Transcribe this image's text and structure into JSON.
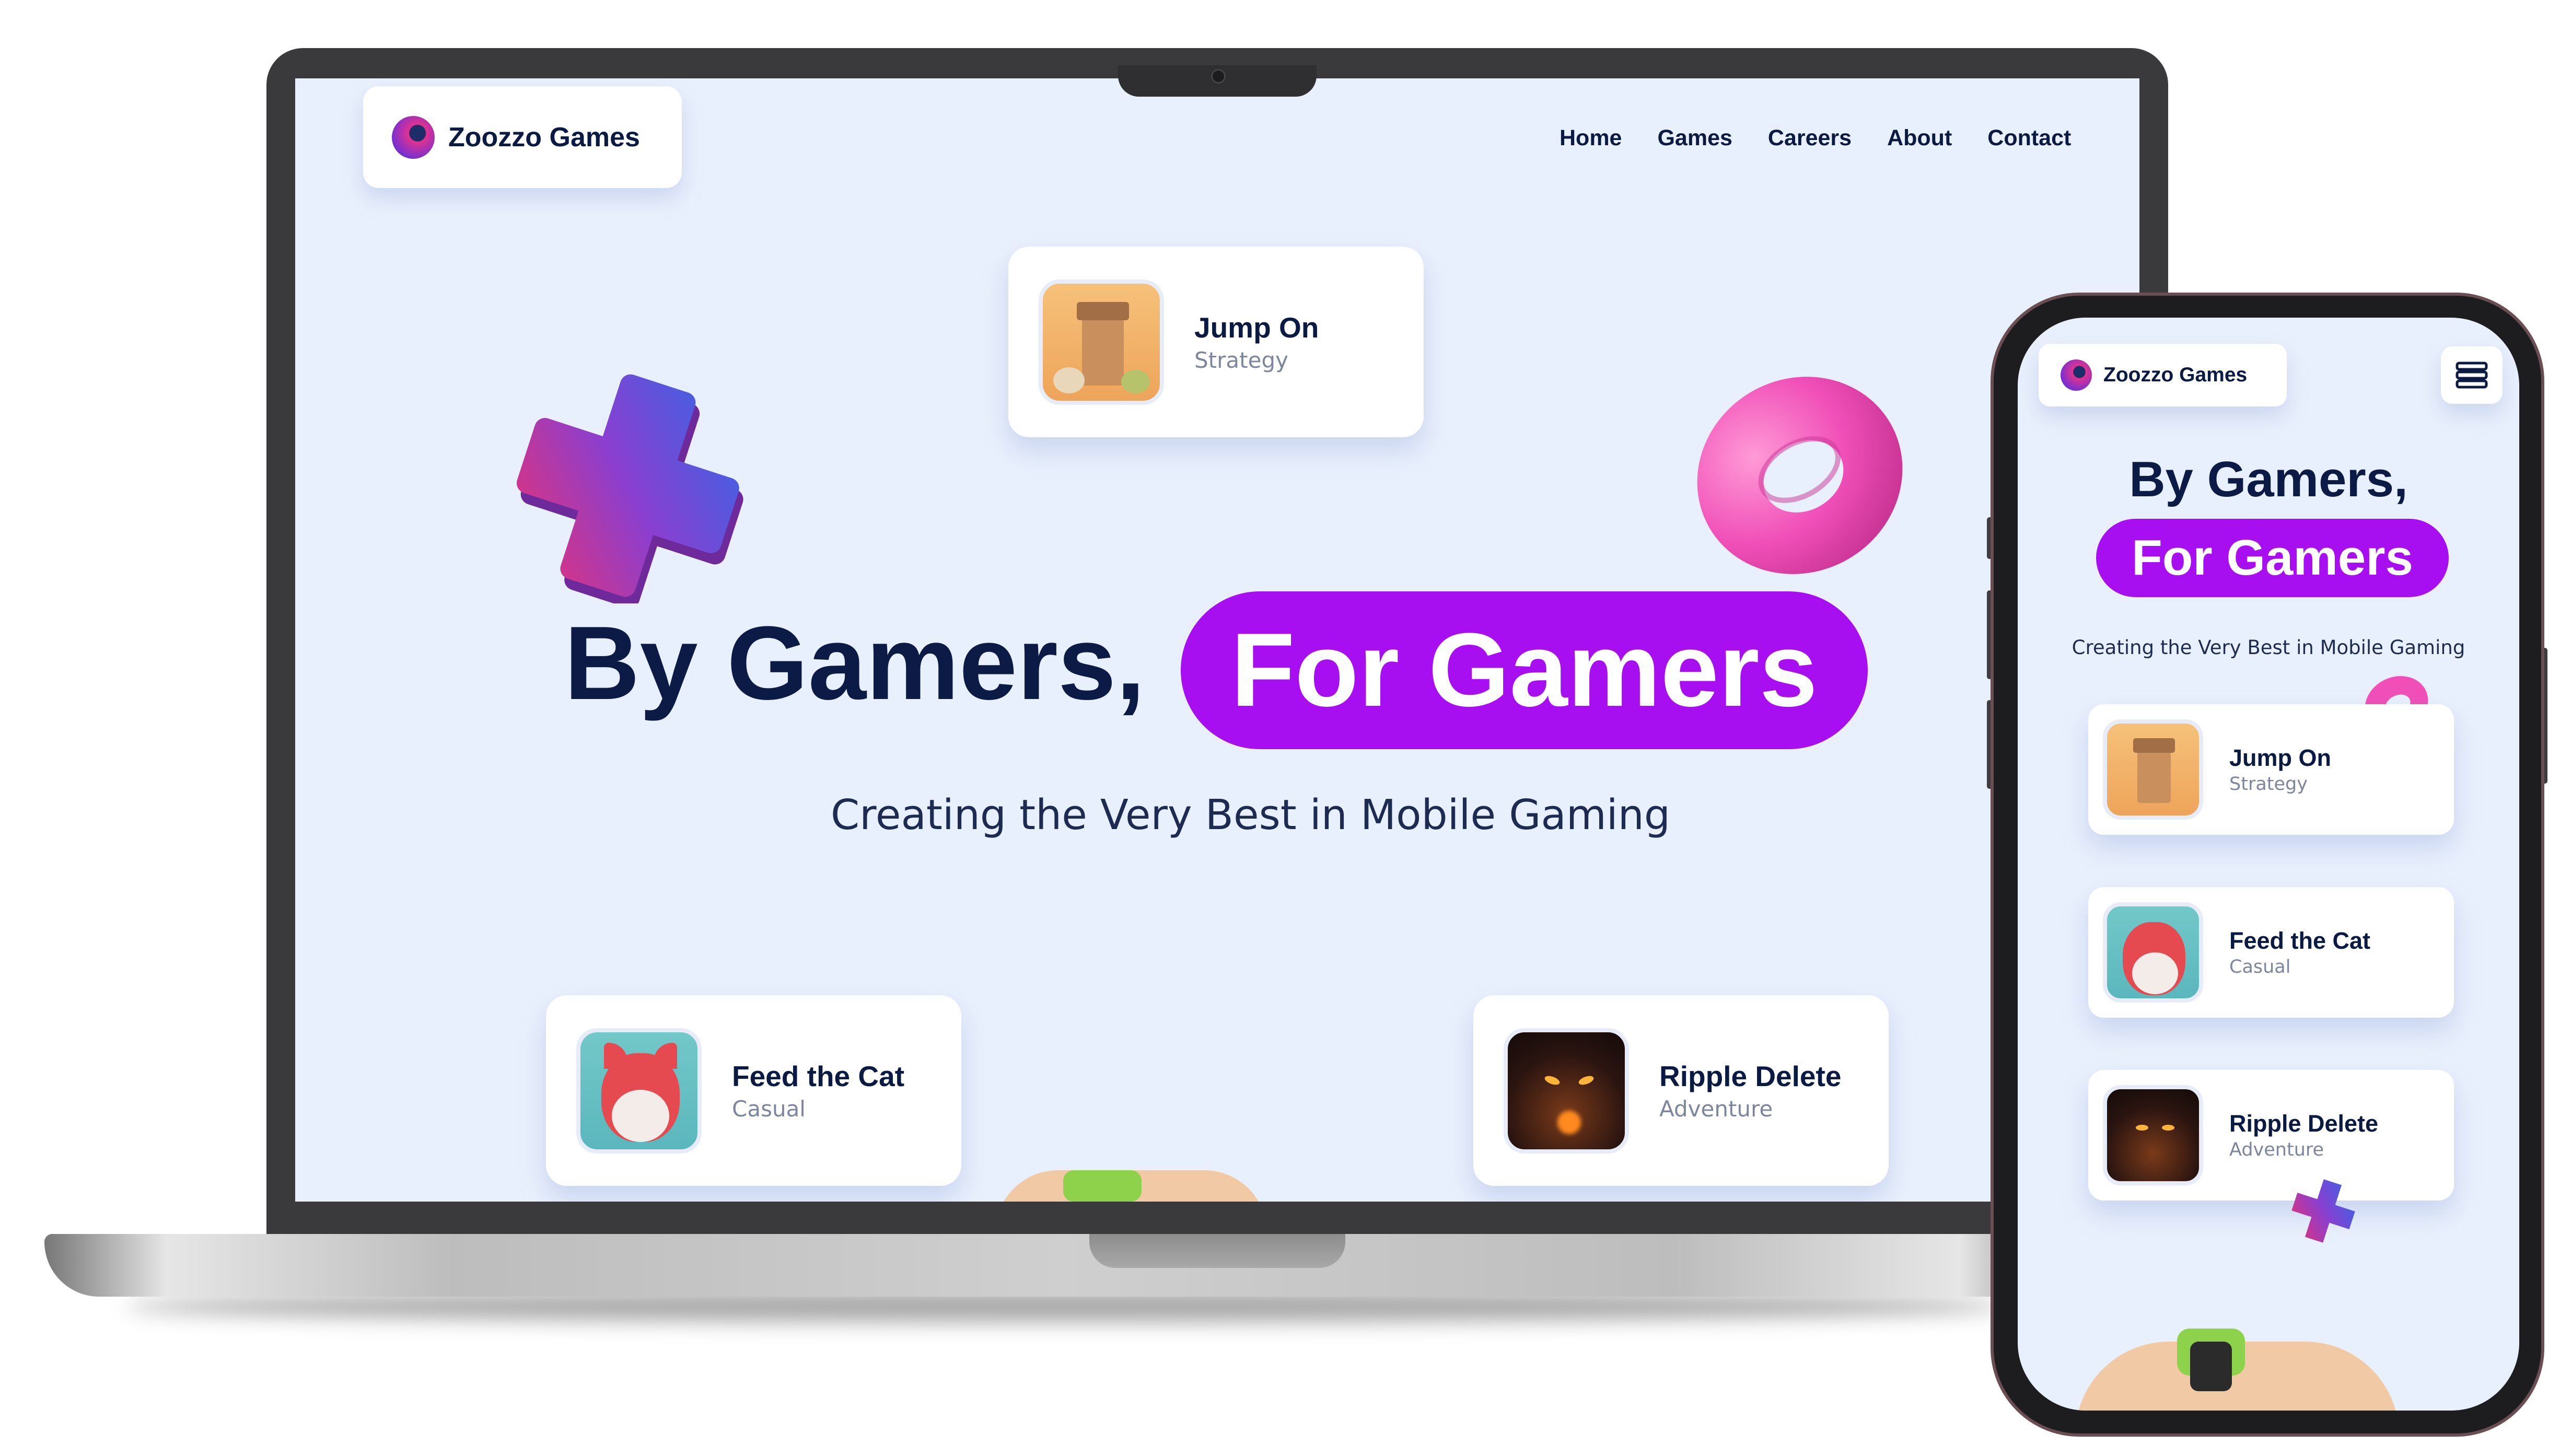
{
  "site": {
    "brand_name": "Zoozzo Games",
    "nav": [
      "Home",
      "Games",
      "Careers",
      "About",
      "Contact"
    ],
    "hero": {
      "line1": "By Gamers,",
      "highlight": "For Gamers",
      "tagline": "Creating the Very Best in Mobile Gaming"
    },
    "games": [
      {
        "name": "Jump On",
        "category": "Strategy",
        "icon": "tower-castle-icon"
      },
      {
        "name": "Feed the Cat",
        "category": "Casual",
        "icon": "cat-character-icon"
      },
      {
        "name": "Ripple Delete",
        "category": "Adventure",
        "icon": "dark-creature-icon"
      }
    ],
    "phone_menu_icon": "menu-icon"
  },
  "colors": {
    "page_bg": "#e9f0fd",
    "accent_purple": "#a80ff0",
    "text_dark": "#0c1b45",
    "muted": "#7d869e",
    "card_bg": "#ffffff"
  }
}
